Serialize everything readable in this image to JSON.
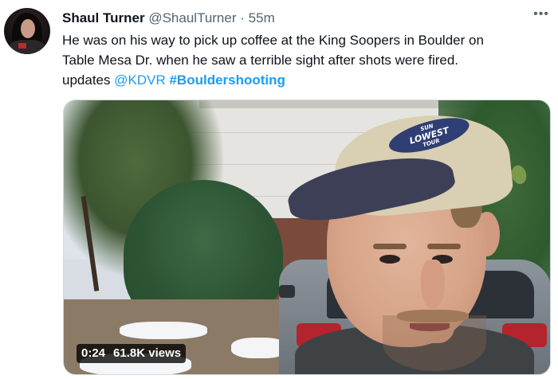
{
  "tweet": {
    "author_name": "Shaul Turner",
    "author_handle": "@ShaulTurner",
    "separator": "·",
    "timestamp": "55m",
    "more_icon": "ellipsis-icon",
    "text_line_1": "He was on his way to pick up coffee at the King Soopers in Boulder on",
    "text_line_2": "Table Mesa Dr. when he saw a terrible sight after shots were fired.",
    "text_line_3_prefix": "updates ",
    "mention": "@KDVR",
    "hashtag": "#Bouldershooting"
  },
  "media": {
    "type": "video",
    "duration": "0:24",
    "views": "61.8K views",
    "cap_text_top": "SUN",
    "cap_text_mid": "LOWEST",
    "cap_text_bot": "TOUR"
  },
  "colors": {
    "link": "#1d9bf0",
    "text": "#0f1419",
    "muted": "#536471"
  }
}
